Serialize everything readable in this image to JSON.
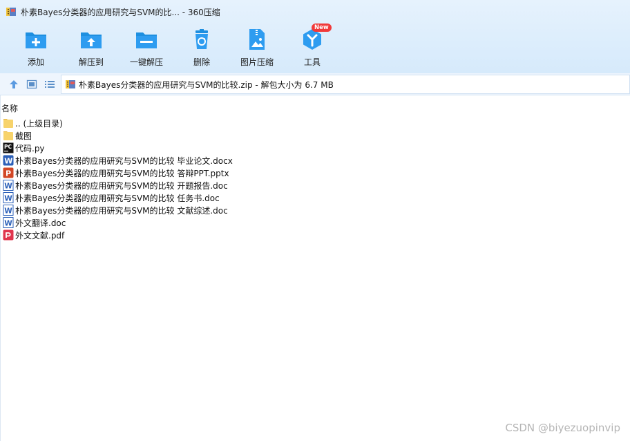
{
  "window": {
    "title": "朴素Bayes分类器的应用研究与SVM的比... - 360压缩"
  },
  "toolbar": {
    "tools": [
      {
        "label": "添加",
        "icon": "add-icon"
      },
      {
        "label": "解压到",
        "icon": "extract-to-icon"
      },
      {
        "label": "一键解压",
        "icon": "one-click-extract-icon"
      },
      {
        "label": "删除",
        "icon": "delete-icon"
      },
      {
        "label": "图片压缩",
        "icon": "image-compress-icon"
      },
      {
        "label": "工具",
        "icon": "tools-icon",
        "badge": "New"
      }
    ]
  },
  "address": {
    "path": "朴素Bayes分类器的应用研究与SVM的比较.zip - 解包大小为 6.7 MB"
  },
  "list": {
    "column_name": "名称",
    "files": [
      {
        "name": ".. (上级目录)",
        "type": "folder"
      },
      {
        "name": "截图",
        "type": "folder"
      },
      {
        "name": "代码.py",
        "type": "py"
      },
      {
        "name": "朴素Bayes分类器的应用研究与SVM的比较 毕业论文.docx",
        "type": "docx"
      },
      {
        "name": "朴素Bayes分类器的应用研究与SVM的比较 答辩PPT.pptx",
        "type": "pptx"
      },
      {
        "name": "朴素Bayes分类器的应用研究与SVM的比较 开题报告.doc",
        "type": "doc"
      },
      {
        "name": "朴素Bayes分类器的应用研究与SVM的比较 任务书.doc",
        "type": "doc"
      },
      {
        "name": "朴素Bayes分类器的应用研究与SVM的比较 文献综述.doc",
        "type": "doc"
      },
      {
        "name": "外文翻译.doc",
        "type": "doc"
      },
      {
        "name": "外文文献.pdf",
        "type": "pdf"
      }
    ]
  },
  "watermark": "CSDN @biyezuopinvip",
  "colors": {
    "accent": "#1e8fe0",
    "header_bg": "#dcedfc",
    "word": "#2b5fb8",
    "ppt": "#d24726",
    "pdf": "#e0354d",
    "folder": "#f7d36b"
  }
}
